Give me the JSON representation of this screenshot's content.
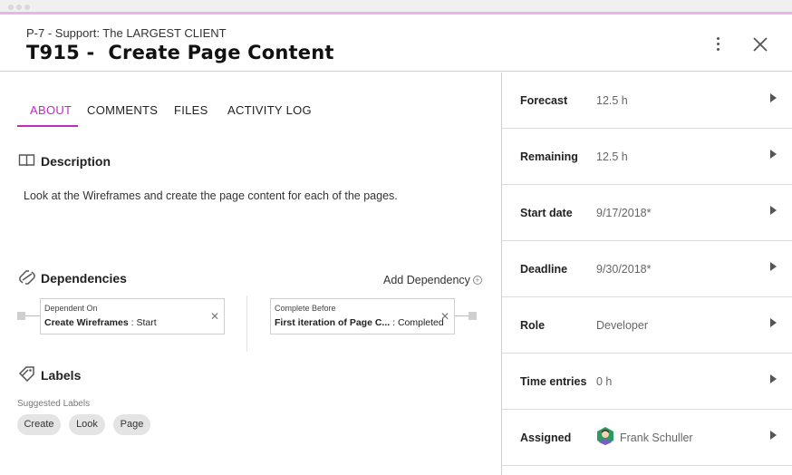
{
  "header": {
    "project": "P-7 - Support: The LARGEST CLIENT",
    "task_title": "T915 -  Create Page Content"
  },
  "tabs": [
    {
      "label": "ABOUT",
      "active": true
    },
    {
      "label": "COMMENTS",
      "active": false
    },
    {
      "label": "FILES",
      "active": false
    },
    {
      "label": "ACTIVITY LOG",
      "active": false
    }
  ],
  "description": {
    "title": "Description",
    "text": "Look at the Wireframes and create the page content for each of the pages."
  },
  "dependencies": {
    "title": "Dependencies",
    "add_label": "Add Dependency",
    "dependent_on": {
      "label": "Dependent On",
      "task": "Create Wireframes",
      "state": " : Start"
    },
    "complete_before": {
      "label": "Complete Before",
      "task": "First iteration of Page C...",
      "state": " : Completed"
    }
  },
  "labels": {
    "title": "Labels",
    "suggested_title": "Suggested Labels",
    "chips": [
      "Create",
      "Look",
      "Page"
    ]
  },
  "details": [
    {
      "label": "Forecast",
      "value": "12.5 h"
    },
    {
      "label": "Remaining",
      "value": "12.5 h"
    },
    {
      "label": "Start date",
      "value": "9/17/2018*"
    },
    {
      "label": "Deadline",
      "value": "9/30/2018*"
    },
    {
      "label": "Role",
      "value": "Developer"
    },
    {
      "label": "Time entries",
      "value": "0 h"
    },
    {
      "label": "Assigned",
      "value": "Frank Schuller"
    }
  ],
  "colors": {
    "accent": "#c02bc2",
    "top_border": "#e8b4ea",
    "avatar_green": "#2e9a63"
  },
  "icons": {
    "more": "kebab-menu-icon",
    "close": "close-icon",
    "description": "book-icon",
    "dependencies": "link-icon",
    "labels": "tag-icon",
    "add": "plus-circle-icon",
    "row_arrow": "caret-right-icon"
  }
}
